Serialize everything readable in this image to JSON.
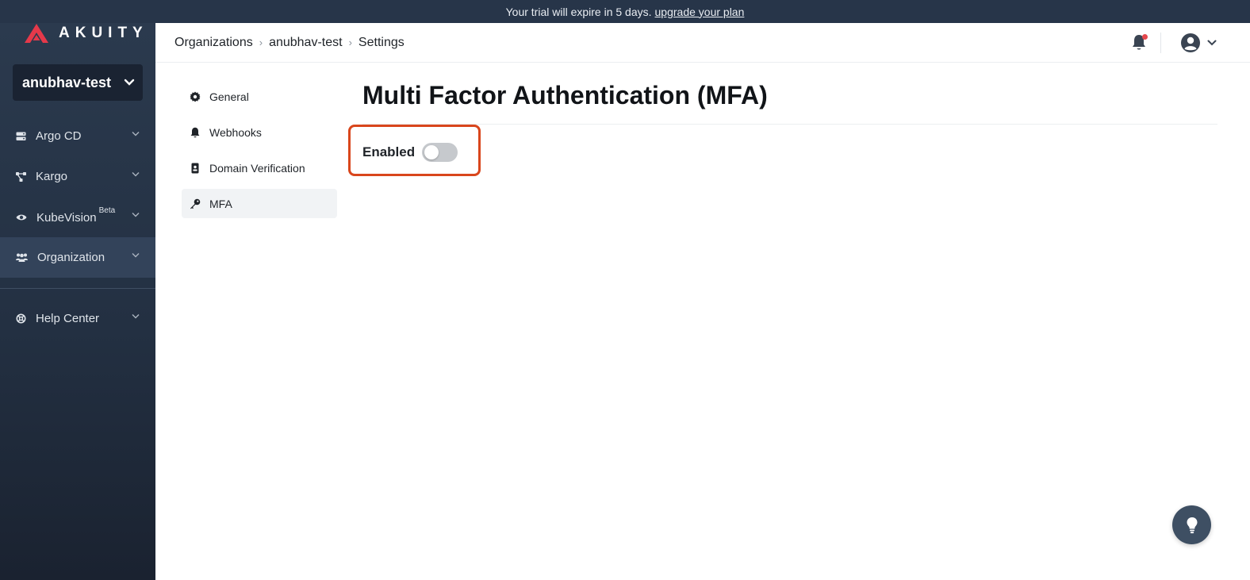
{
  "banner": {
    "text": "Your trial will expire in 5 days.",
    "link": "upgrade your plan"
  },
  "brand": {
    "name": "AKUITY",
    "color": "#e5394a"
  },
  "sidebar": {
    "org_name": "anubhav-test",
    "items": [
      {
        "label": "Argo CD",
        "icon": "server-icon"
      },
      {
        "label": "Kargo",
        "icon": "graph-icon"
      },
      {
        "label": "KubeVision",
        "badge": "Beta",
        "icon": "eye-icon"
      },
      {
        "label": "Organization",
        "icon": "users-icon",
        "active": true
      }
    ],
    "help": {
      "label": "Help Center",
      "icon": "lifebuoy-icon"
    }
  },
  "breadcrumb": {
    "root": "Organizations",
    "org": "anubhav-test",
    "current": "Settings"
  },
  "subnav": {
    "items": [
      {
        "label": "General",
        "icon": "gear-icon"
      },
      {
        "label": "Webhooks",
        "icon": "bell-icon"
      },
      {
        "label": "Domain Verification",
        "icon": "id-badge-icon"
      },
      {
        "label": "MFA",
        "icon": "key-icon",
        "active": true
      }
    ]
  },
  "main": {
    "title": "Multi Factor Authentication (MFA)",
    "toggle_label": "Enabled",
    "toggle_on": false,
    "highlight_color": "#d9461c"
  },
  "notifications": {
    "has_unread": true
  }
}
